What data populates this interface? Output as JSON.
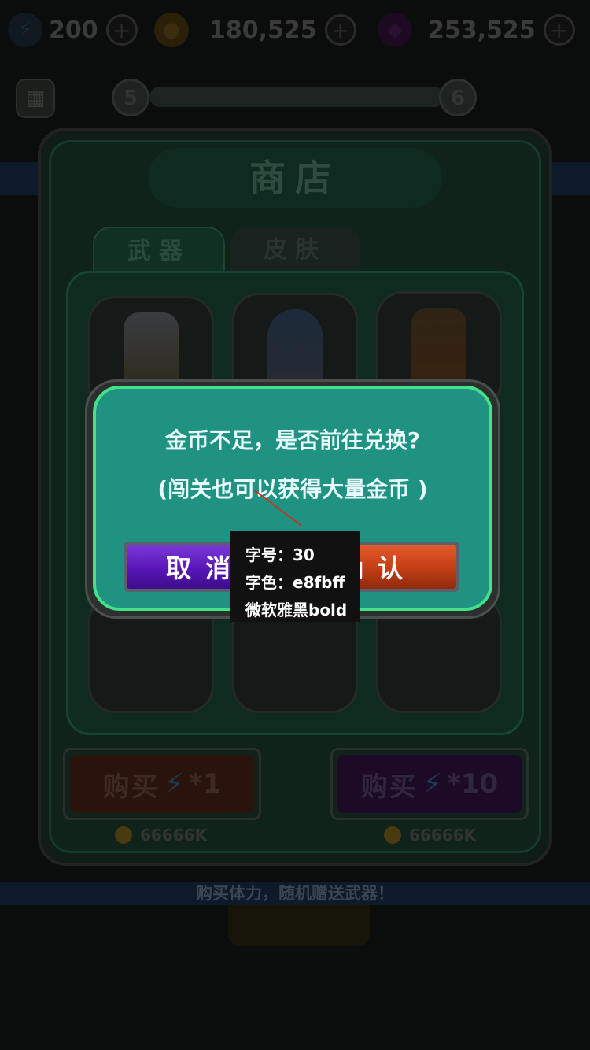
{
  "resources": [
    {
      "icon": "energy-bolt-icon",
      "value": "200"
    },
    {
      "icon": "gold-coin-icon",
      "value": "180,525"
    },
    {
      "icon": "purple-gem-icon",
      "value": "253,525"
    }
  ],
  "level": {
    "current": "5",
    "next": "6",
    "progress": 0.0
  },
  "shop": {
    "title": "商店",
    "tabs": [
      {
        "label": "武器",
        "active": true
      },
      {
        "label": "皮肤",
        "active": false
      }
    ],
    "buy": [
      {
        "label": "购买",
        "multiplier": "*1",
        "price": "66666K"
      },
      {
        "label": "购买",
        "multiplier": "*10",
        "price": "66666K"
      }
    ],
    "promo": "购买体力，随机赠送武器！"
  },
  "dialog": {
    "line1": "金币不足，是否前往兑换?",
    "line2": "(闯关也可以获得大量金币 )",
    "cancel_label": "取消",
    "confirm_label": "确认"
  },
  "annotation": {
    "size": "字号：30",
    "color": "字色：e8fbff",
    "font": "微软雅黑bold"
  },
  "colors": {
    "dialog_text": "#e8fbff",
    "dialog_bg": "#1f9282",
    "dialog_border": "#44e08a",
    "cancel_purple": "#5a16b8",
    "confirm_orange": "#c23e16"
  }
}
